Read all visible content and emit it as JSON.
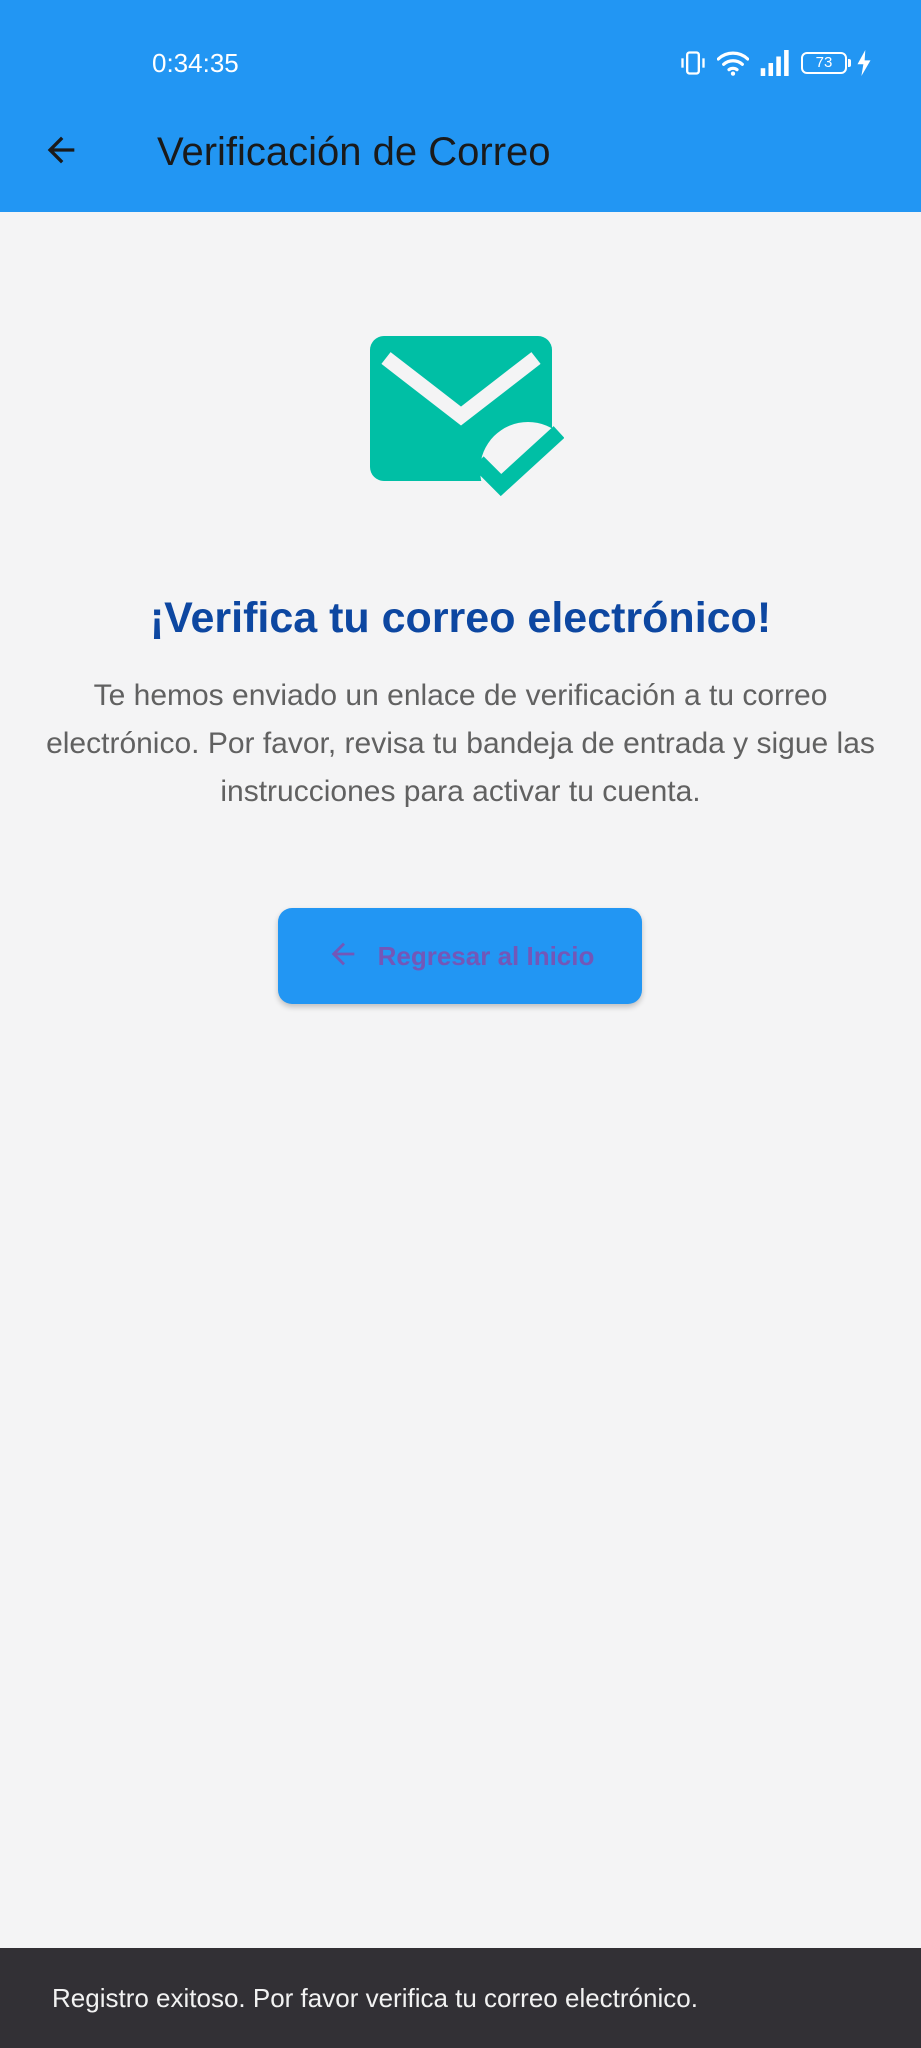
{
  "status_bar": {
    "time": "0:34:35",
    "battery_level": "73",
    "icons": [
      "vibrate-icon",
      "wifi-icon",
      "signal-icon",
      "battery-icon",
      "charging-icon"
    ]
  },
  "toolbar": {
    "back_icon": "arrow-left-icon",
    "title": "Verificación de Correo"
  },
  "hero": {
    "icon": "mark-email-read-icon"
  },
  "content": {
    "headline": "¡Verifica tu correo electrónico!",
    "description": "Te hemos enviado un enlace de verificación a tu correo electrónico. Por favor, revisa tu bandeja de entrada y sigue las instrucciones para activar tu cuenta."
  },
  "actions": {
    "back_home_icon": "arrow-left-icon",
    "back_home_label": "Regresar al Inicio"
  },
  "snackbar": {
    "message": "Registro exitoso. Por favor verifica tu correo electrónico."
  },
  "colors": {
    "app_bar": "#2296f3",
    "background": "#f4f4f5",
    "hero_icon": "#00bfa5",
    "headline": "#0d47a1",
    "body_text": "#616161",
    "button_bg": "#2296f3",
    "button_text": "#7357b8",
    "snackbar_bg": "#323035"
  }
}
